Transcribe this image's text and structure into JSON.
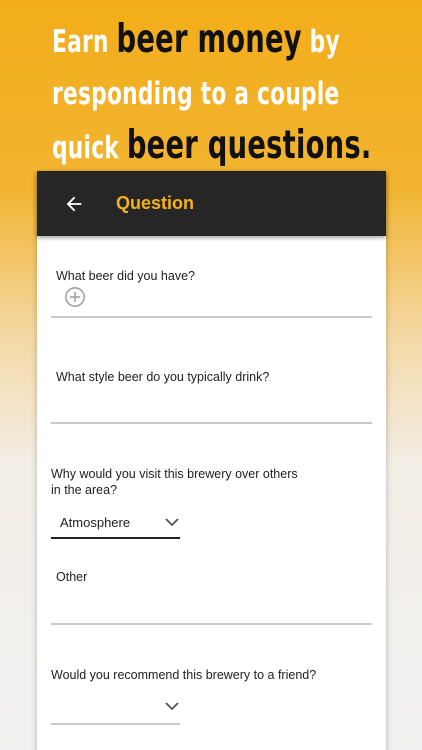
{
  "hero": {
    "line1_a": "Earn",
    "line1_b": "beer money",
    "line1_c": "by",
    "line2": "responding to a couple",
    "line3_a": "quick",
    "line3_b": "beer questions."
  },
  "appbar": {
    "title": "Question",
    "back_icon": "arrow-left-icon"
  },
  "questions": {
    "q1": {
      "label": "What beer did you have?",
      "icon": "add-circle-icon"
    },
    "q2": {
      "label": "What style beer do you typically drink?"
    },
    "q3": {
      "label_line1": "Why would you visit this brewery over others",
      "label_line2": "in the area?",
      "selected": "Atmosphere"
    },
    "q4": {
      "label": "Other"
    },
    "q5": {
      "label": "Would you recommend this brewery to a friend?",
      "selected": ""
    }
  },
  "colors": {
    "accent": "#f6b21b",
    "appbar_bg": "#262626",
    "hero_bg": "#f3ad1a"
  }
}
